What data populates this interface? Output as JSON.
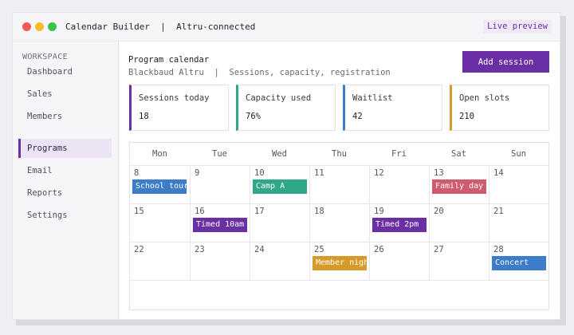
{
  "window": {
    "title": "Calendar Builder  |  Altru-connected",
    "live_preview": "Live preview"
  },
  "sidebar": {
    "heading": "WORKSPACE",
    "items": [
      {
        "label": "Dashboard",
        "active": false
      },
      {
        "label": "Sales",
        "active": false
      },
      {
        "label": "Members",
        "active": false
      },
      {
        "label": "Programs",
        "active": true
      },
      {
        "label": "Email",
        "active": false
      },
      {
        "label": "Reports",
        "active": false
      },
      {
        "label": "Settings",
        "active": false
      }
    ]
  },
  "header": {
    "title": "Program calendar",
    "subtitle": "Blackbaud Altru  |  Sessions, capacity, registration",
    "add_button": "Add session"
  },
  "kpis": [
    {
      "label": "Sessions today",
      "value": "18",
      "color": "#6b2fa5"
    },
    {
      "label": "Capacity used",
      "value": "76%",
      "color": "#2fa88a"
    },
    {
      "label": "Waitlist",
      "value": "42",
      "color": "#3d7cc9"
    },
    {
      "label": "Open slots",
      "value": "210",
      "color": "#d69a2a"
    }
  ],
  "calendar": {
    "weekdays": [
      "Mon",
      "Tue",
      "Wed",
      "Thu",
      "Fri",
      "Sat",
      "Sun"
    ],
    "weeks": [
      [
        {
          "day": "8",
          "event": {
            "label": "School tour",
            "color": "#3d7cc9"
          }
        },
        {
          "day": "9"
        },
        {
          "day": "10",
          "event": {
            "label": "Camp A",
            "color": "#2fa88a"
          }
        },
        {
          "day": "11"
        },
        {
          "day": "12"
        },
        {
          "day": "13",
          "event": {
            "label": "Family day",
            "color": "#d05a6e"
          }
        },
        {
          "day": "14"
        }
      ],
      [
        {
          "day": "15"
        },
        {
          "day": "16",
          "event": {
            "label": "Timed 10am",
            "color": "#6b2fa5"
          }
        },
        {
          "day": "17"
        },
        {
          "day": "18"
        },
        {
          "day": "19",
          "event": {
            "label": "Timed 2pm",
            "color": "#6b2fa5"
          }
        },
        {
          "day": "20"
        },
        {
          "day": "21"
        }
      ],
      [
        {
          "day": "22"
        },
        {
          "day": "23"
        },
        {
          "day": "24"
        },
        {
          "day": "25",
          "event": {
            "label": "Member night",
            "color": "#d69a2a"
          }
        },
        {
          "day": "26"
        },
        {
          "day": "27"
        },
        {
          "day": "28",
          "event": {
            "label": "Concert",
            "color": "#3d7cc9"
          }
        }
      ]
    ]
  }
}
